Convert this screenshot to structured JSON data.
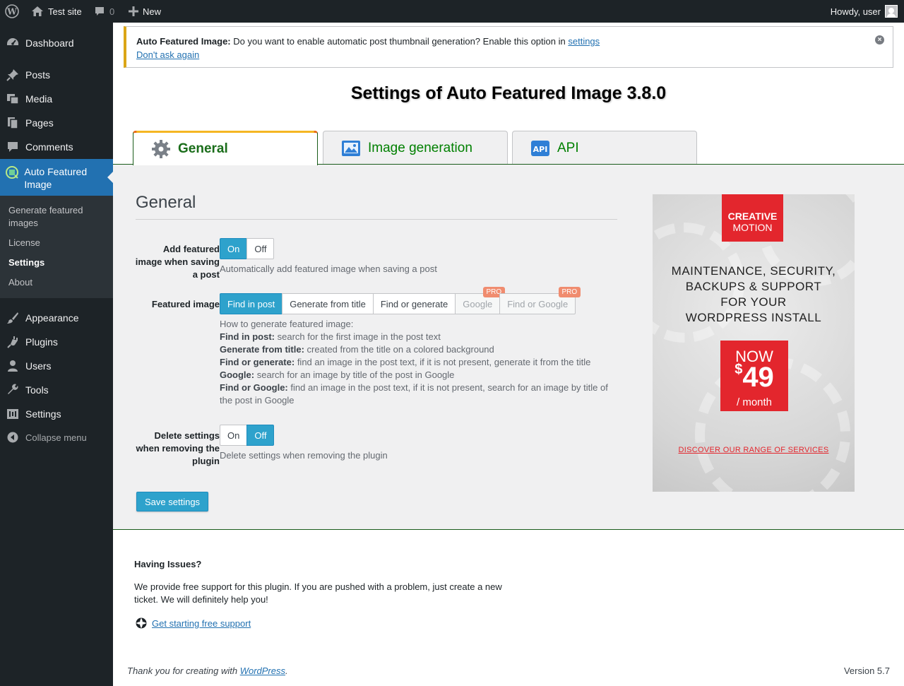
{
  "adminbar": {
    "site_name": "Test site",
    "comments_count": "0",
    "new_label": "New",
    "greeting": "Howdy, user"
  },
  "sidebar": {
    "items": [
      {
        "label": "Dashboard",
        "icon": "dashboard-icon"
      },
      {
        "label": "Posts",
        "icon": "pin-icon"
      },
      {
        "label": "Media",
        "icon": "media-icon"
      },
      {
        "label": "Pages",
        "icon": "pages-icon"
      },
      {
        "label": "Comments",
        "icon": "comment-icon"
      },
      {
        "label": "Auto Featured Image",
        "icon": "image-plugin-icon"
      },
      {
        "label": "Appearance",
        "icon": "brush-icon"
      },
      {
        "label": "Plugins",
        "icon": "plug-icon"
      },
      {
        "label": "Users",
        "icon": "user-icon"
      },
      {
        "label": "Tools",
        "icon": "wrench-icon"
      },
      {
        "label": "Settings",
        "icon": "settings-icon"
      }
    ],
    "submenu": [
      "Generate featured images",
      "License",
      "Settings",
      "About"
    ],
    "collapse_label": "Collapse menu"
  },
  "notice": {
    "strong": "Auto Featured Image:",
    "text": "Do you want to enable automatic post thumbnail generation? Enable this option in",
    "link": "settings",
    "dismiss_link": "Don't ask again"
  },
  "page_title": "Settings of Auto Featured Image 3.8.0",
  "tabs": [
    {
      "label": "General",
      "active": true
    },
    {
      "label": "Image generation",
      "active": false
    },
    {
      "label": "API",
      "active": false
    }
  ],
  "general": {
    "title": "General",
    "add_featured": {
      "label": "Add featured image when saving a post",
      "options": [
        "On",
        "Off"
      ],
      "selected": "On",
      "description": "Automatically add featured image when saving a post"
    },
    "featured_image": {
      "label": "Featured image",
      "options": [
        "Find in post",
        "Generate from title",
        "Find or generate",
        "Google",
        "Find or Google"
      ],
      "selected": "Find in post",
      "pro_badge": "PRO",
      "how_to": "How to generate featured image:",
      "items": [
        {
          "term": "Find in post:",
          "text": "search for the first image in the post text"
        },
        {
          "term": "Generate from title:",
          "text": "created from the title on a colored background"
        },
        {
          "term": "Find or generate:",
          "text": "find an image in the post text, if it is not present, generate it from the title"
        },
        {
          "term": "Google:",
          "text": "search for an image by title of the post in Google"
        },
        {
          "term": "Find or Google:",
          "text": "find an image in the post text, if it is not present, search for an image by title of the post in Google"
        }
      ]
    },
    "delete_settings": {
      "label": "Delete settings when removing the plugin",
      "options": [
        "On",
        "Off"
      ],
      "selected": "Off",
      "description": "Delete settings when removing the plugin"
    },
    "save_label": "Save settings"
  },
  "ad": {
    "logo_line1": "CREATIVE",
    "logo_line2": "MOTION",
    "headline_lines": [
      "MAINTENANCE, SECURITY,",
      "BACKUPS & SUPPORT",
      "FOR YOUR",
      "WORDPRESS INSTALL"
    ],
    "now": "NOW",
    "currency": "$",
    "amount": "49",
    "per": "/ month",
    "link": "DISCOVER OUR RANGE OF SERVICES"
  },
  "issues": {
    "title": "Having Issues?",
    "text": "We provide free support for this plugin. If you are pushed with a problem, just create a new ticket. We will definitely help you!",
    "link": "Get starting free support"
  },
  "footer": {
    "thanks_prefix": "Thank you for creating with",
    "thanks_link": "WordPress",
    "thanks_suffix": ".",
    "version": "Version 5.7"
  },
  "colors": {
    "admin_dark": "#1d2327",
    "wp_blue": "#2271b1",
    "toggle_blue": "#2ea2cc",
    "tab_green": "#008000",
    "ad_red": "#e3262d"
  }
}
